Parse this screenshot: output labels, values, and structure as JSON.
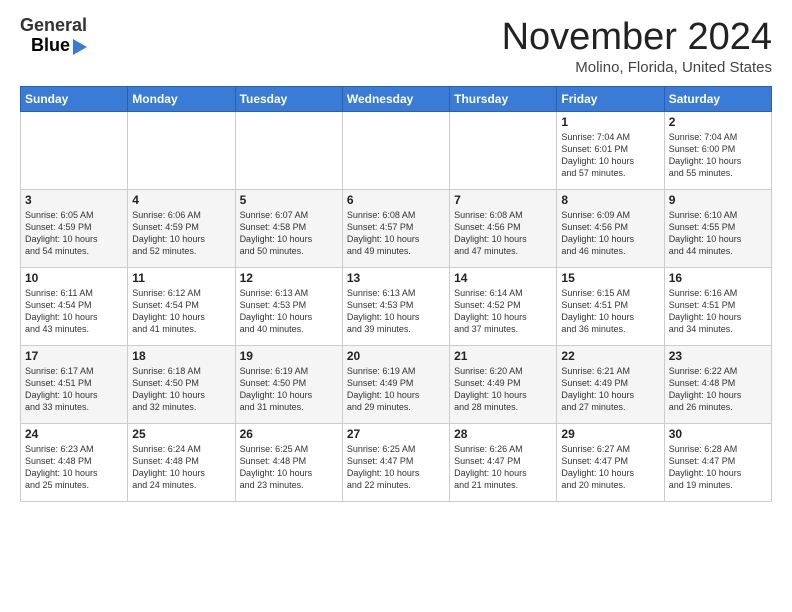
{
  "header": {
    "logo_line1": "General",
    "logo_line2": "Blue",
    "month": "November 2024",
    "location": "Molino, Florida, United States"
  },
  "weekdays": [
    "Sunday",
    "Monday",
    "Tuesday",
    "Wednesday",
    "Thursday",
    "Friday",
    "Saturday"
  ],
  "weeks": [
    [
      {
        "day": "",
        "info": ""
      },
      {
        "day": "",
        "info": ""
      },
      {
        "day": "",
        "info": ""
      },
      {
        "day": "",
        "info": ""
      },
      {
        "day": "",
        "info": ""
      },
      {
        "day": "1",
        "info": "Sunrise: 7:04 AM\nSunset: 6:01 PM\nDaylight: 10 hours\nand 57 minutes."
      },
      {
        "day": "2",
        "info": "Sunrise: 7:04 AM\nSunset: 6:00 PM\nDaylight: 10 hours\nand 55 minutes."
      }
    ],
    [
      {
        "day": "3",
        "info": "Sunrise: 6:05 AM\nSunset: 4:59 PM\nDaylight: 10 hours\nand 54 minutes."
      },
      {
        "day": "4",
        "info": "Sunrise: 6:06 AM\nSunset: 4:59 PM\nDaylight: 10 hours\nand 52 minutes."
      },
      {
        "day": "5",
        "info": "Sunrise: 6:07 AM\nSunset: 4:58 PM\nDaylight: 10 hours\nand 50 minutes."
      },
      {
        "day": "6",
        "info": "Sunrise: 6:08 AM\nSunset: 4:57 PM\nDaylight: 10 hours\nand 49 minutes."
      },
      {
        "day": "7",
        "info": "Sunrise: 6:08 AM\nSunset: 4:56 PM\nDaylight: 10 hours\nand 47 minutes."
      },
      {
        "day": "8",
        "info": "Sunrise: 6:09 AM\nSunset: 4:56 PM\nDaylight: 10 hours\nand 46 minutes."
      },
      {
        "day": "9",
        "info": "Sunrise: 6:10 AM\nSunset: 4:55 PM\nDaylight: 10 hours\nand 44 minutes."
      }
    ],
    [
      {
        "day": "10",
        "info": "Sunrise: 6:11 AM\nSunset: 4:54 PM\nDaylight: 10 hours\nand 43 minutes."
      },
      {
        "day": "11",
        "info": "Sunrise: 6:12 AM\nSunset: 4:54 PM\nDaylight: 10 hours\nand 41 minutes."
      },
      {
        "day": "12",
        "info": "Sunrise: 6:13 AM\nSunset: 4:53 PM\nDaylight: 10 hours\nand 40 minutes."
      },
      {
        "day": "13",
        "info": "Sunrise: 6:13 AM\nSunset: 4:53 PM\nDaylight: 10 hours\nand 39 minutes."
      },
      {
        "day": "14",
        "info": "Sunrise: 6:14 AM\nSunset: 4:52 PM\nDaylight: 10 hours\nand 37 minutes."
      },
      {
        "day": "15",
        "info": "Sunrise: 6:15 AM\nSunset: 4:51 PM\nDaylight: 10 hours\nand 36 minutes."
      },
      {
        "day": "16",
        "info": "Sunrise: 6:16 AM\nSunset: 4:51 PM\nDaylight: 10 hours\nand 34 minutes."
      }
    ],
    [
      {
        "day": "17",
        "info": "Sunrise: 6:17 AM\nSunset: 4:51 PM\nDaylight: 10 hours\nand 33 minutes."
      },
      {
        "day": "18",
        "info": "Sunrise: 6:18 AM\nSunset: 4:50 PM\nDaylight: 10 hours\nand 32 minutes."
      },
      {
        "day": "19",
        "info": "Sunrise: 6:19 AM\nSunset: 4:50 PM\nDaylight: 10 hours\nand 31 minutes."
      },
      {
        "day": "20",
        "info": "Sunrise: 6:19 AM\nSunset: 4:49 PM\nDaylight: 10 hours\nand 29 minutes."
      },
      {
        "day": "21",
        "info": "Sunrise: 6:20 AM\nSunset: 4:49 PM\nDaylight: 10 hours\nand 28 minutes."
      },
      {
        "day": "22",
        "info": "Sunrise: 6:21 AM\nSunset: 4:49 PM\nDaylight: 10 hours\nand 27 minutes."
      },
      {
        "day": "23",
        "info": "Sunrise: 6:22 AM\nSunset: 4:48 PM\nDaylight: 10 hours\nand 26 minutes."
      }
    ],
    [
      {
        "day": "24",
        "info": "Sunrise: 6:23 AM\nSunset: 4:48 PM\nDaylight: 10 hours\nand 25 minutes."
      },
      {
        "day": "25",
        "info": "Sunrise: 6:24 AM\nSunset: 4:48 PM\nDaylight: 10 hours\nand 24 minutes."
      },
      {
        "day": "26",
        "info": "Sunrise: 6:25 AM\nSunset: 4:48 PM\nDaylight: 10 hours\nand 23 minutes."
      },
      {
        "day": "27",
        "info": "Sunrise: 6:25 AM\nSunset: 4:47 PM\nDaylight: 10 hours\nand 22 minutes."
      },
      {
        "day": "28",
        "info": "Sunrise: 6:26 AM\nSunset: 4:47 PM\nDaylight: 10 hours\nand 21 minutes."
      },
      {
        "day": "29",
        "info": "Sunrise: 6:27 AM\nSunset: 4:47 PM\nDaylight: 10 hours\nand 20 minutes."
      },
      {
        "day": "30",
        "info": "Sunrise: 6:28 AM\nSunset: 4:47 PM\nDaylight: 10 hours\nand 19 minutes."
      }
    ]
  ]
}
